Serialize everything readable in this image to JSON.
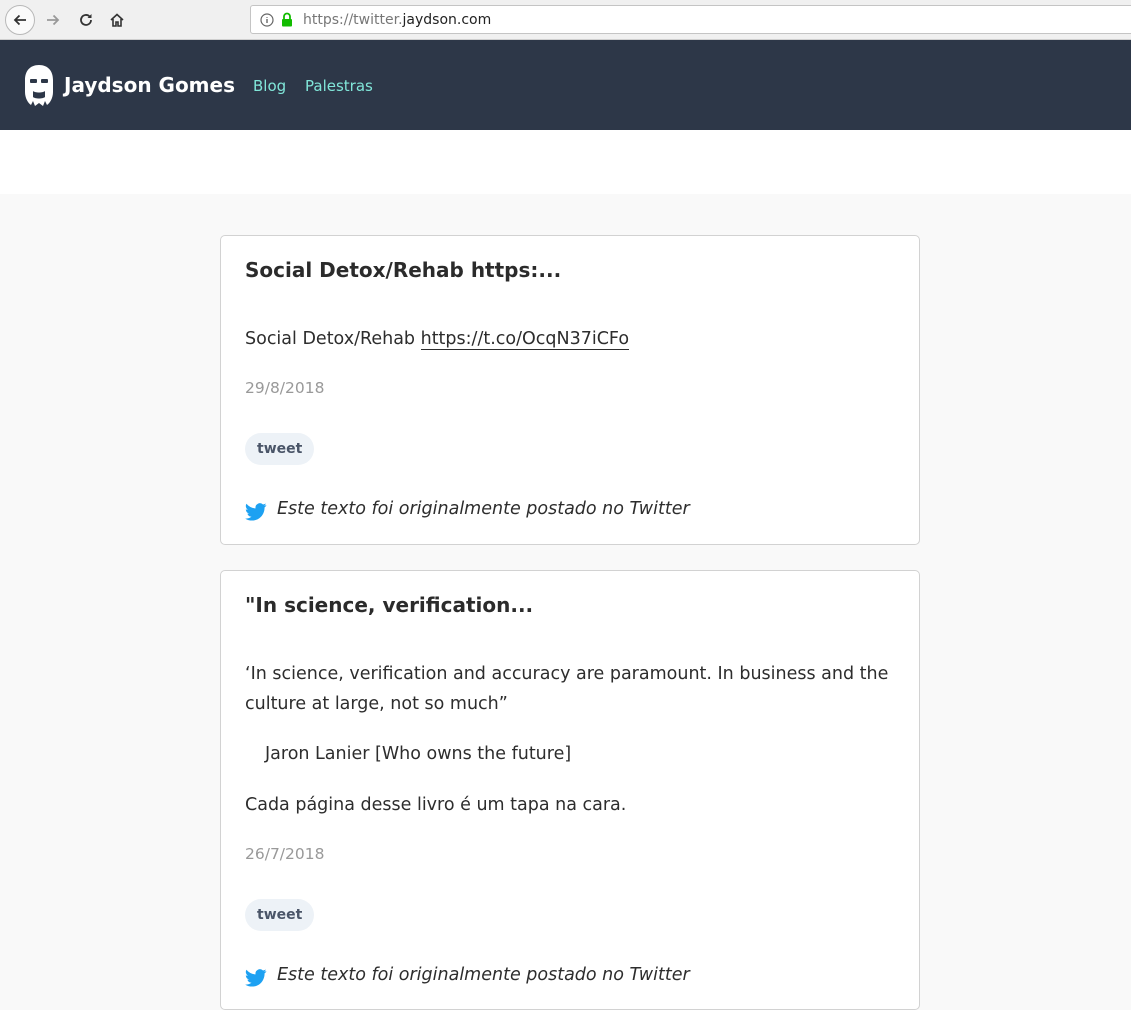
{
  "browser": {
    "url_prefix": "https://twitter.",
    "url_domain": "jaydson.com"
  },
  "site": {
    "brand": "Jaydson Gomes",
    "nav": [
      {
        "label": "Blog"
      },
      {
        "label": "Palestras"
      }
    ]
  },
  "posts": [
    {
      "title": "Social Detox/Rehab https:...",
      "body_text": "Social Detox/Rehab ",
      "body_link": "https://t.co/OcqN37iCFo",
      "date": "29/8/2018",
      "tag": "tweet",
      "origin": "Este texto foi originalmente postado no Twitter"
    },
    {
      "title": "\"In science, verification...",
      "quote": "‘In science, verification and accuracy are paramount. In business and the culture at large, not so much”",
      "cite": "Jaron Lanier [Who owns the future]",
      "comment": "Cada página desse livro é um tapa na cara.",
      "date": "26/7/2018",
      "tag": "tweet",
      "origin": "Este texto foi originalmente postado no Twitter"
    }
  ],
  "colors": {
    "header_bg": "#2d3748",
    "nav_link": "#81e6d9",
    "twitter_blue": "#1da1f2"
  }
}
